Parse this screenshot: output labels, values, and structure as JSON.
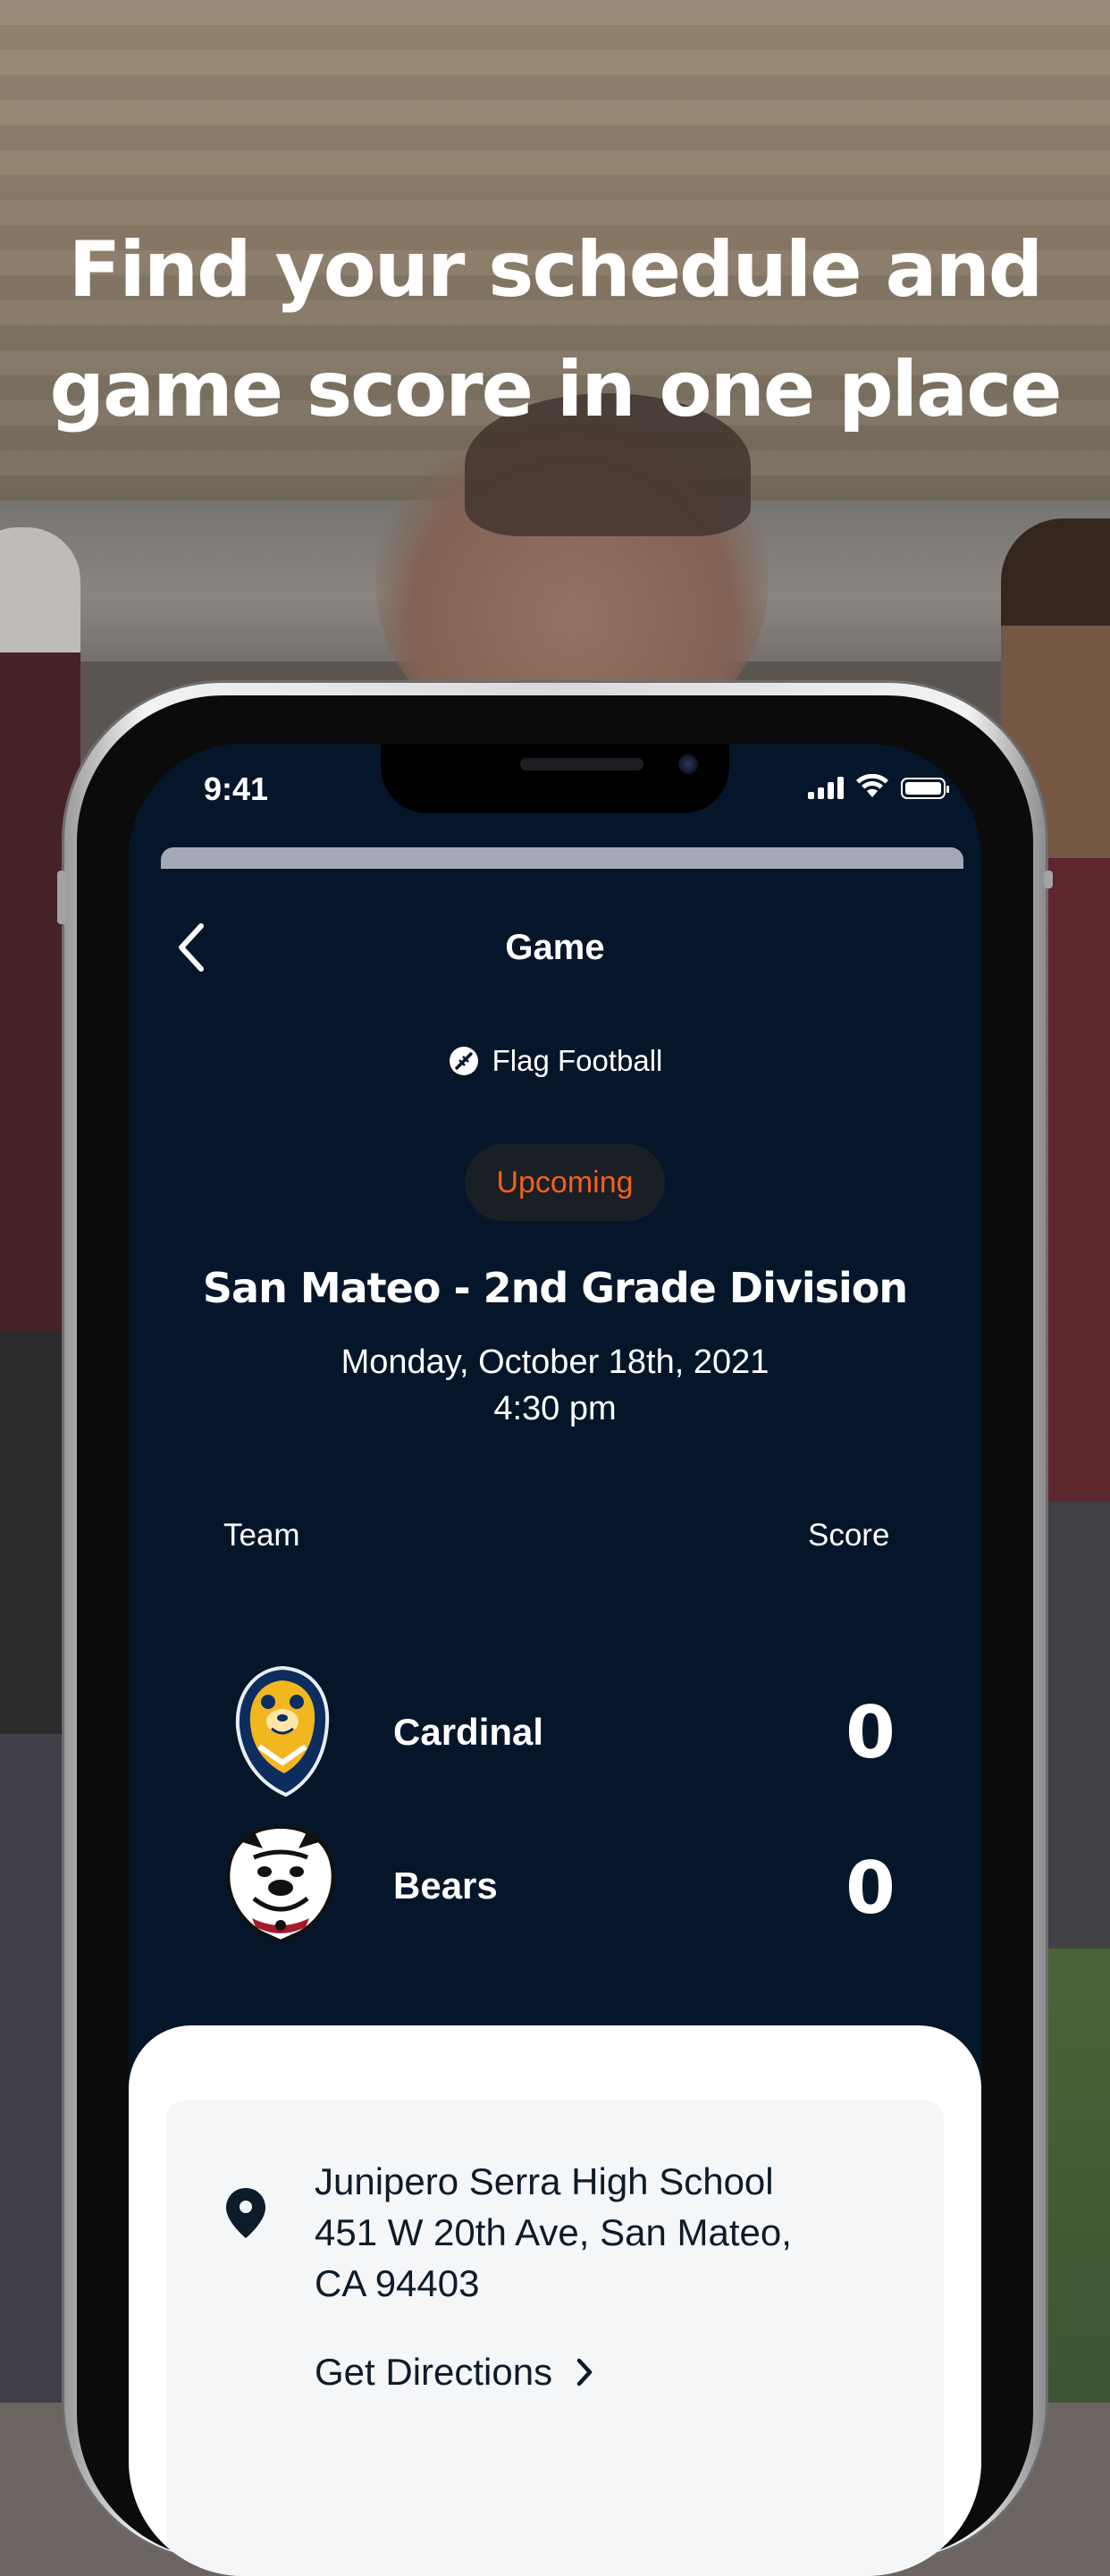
{
  "headline": {
    "line1": "Find your schedule and",
    "line2": "game score in one place"
  },
  "status_bar": {
    "time": "9:41"
  },
  "nav": {
    "title": "Game",
    "back_icon": "chevron-left-icon"
  },
  "game": {
    "sport_icon": "football-icon",
    "sport": "Flag Football",
    "status": "Upcoming",
    "division": "San Mateo - 2nd Grade Division",
    "date": "Monday, October 18th, 2021",
    "time": "4:30 pm"
  },
  "scoreboard": {
    "team_header": "Team",
    "score_header": "Score",
    "teams": [
      {
        "name": "Cardinal",
        "score": "0",
        "logo": "bear-logo-icon"
      },
      {
        "name": "Bears",
        "score": "0",
        "logo": "bulldog-logo-icon"
      }
    ]
  },
  "location": {
    "icon": "map-pin-icon",
    "line1": "Junipero Serra High School",
    "line2": "451 W 20th Ave, San Mateo,",
    "line3": "CA 94403",
    "directions_label": "Get Directions"
  },
  "colors": {
    "screen_bg": "#06162a",
    "status_accent": "#f2611b",
    "sheet_bg": "#ffffff",
    "card_bg": "#f4f6f8"
  }
}
